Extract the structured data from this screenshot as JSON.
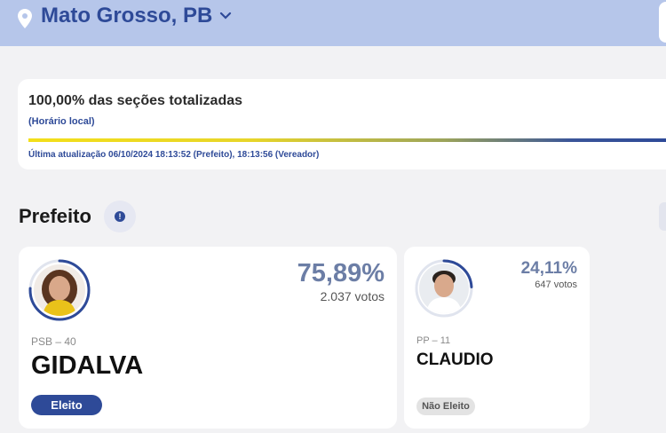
{
  "header": {
    "location": "Mato Grosso, PB"
  },
  "status": {
    "sections_totalized": "100,00% das seções totalizadas",
    "local_time_note": "(Horário local)",
    "progress_percent": 100,
    "last_update": "Última atualização 06/10/2024 18:13:52 (Prefeito), 18:13:56 (Vereador)"
  },
  "section": {
    "title": "Prefeito"
  },
  "candidates": [
    {
      "percent": "75,89%",
      "percent_value": 75.89,
      "votes": "2.037 votos",
      "party": "PSB – 40",
      "name": "GIDALVA",
      "status": "Eleito"
    },
    {
      "percent": "24,11%",
      "percent_value": 24.11,
      "votes": "647 votos",
      "party": "PP – 11",
      "name": "CLAUDIO",
      "status": "Não Eleito"
    }
  ],
  "colors": {
    "brand_blue": "#2e4a98",
    "header_bg": "#b6c6ea",
    "percent_text": "#6c7ea6"
  }
}
